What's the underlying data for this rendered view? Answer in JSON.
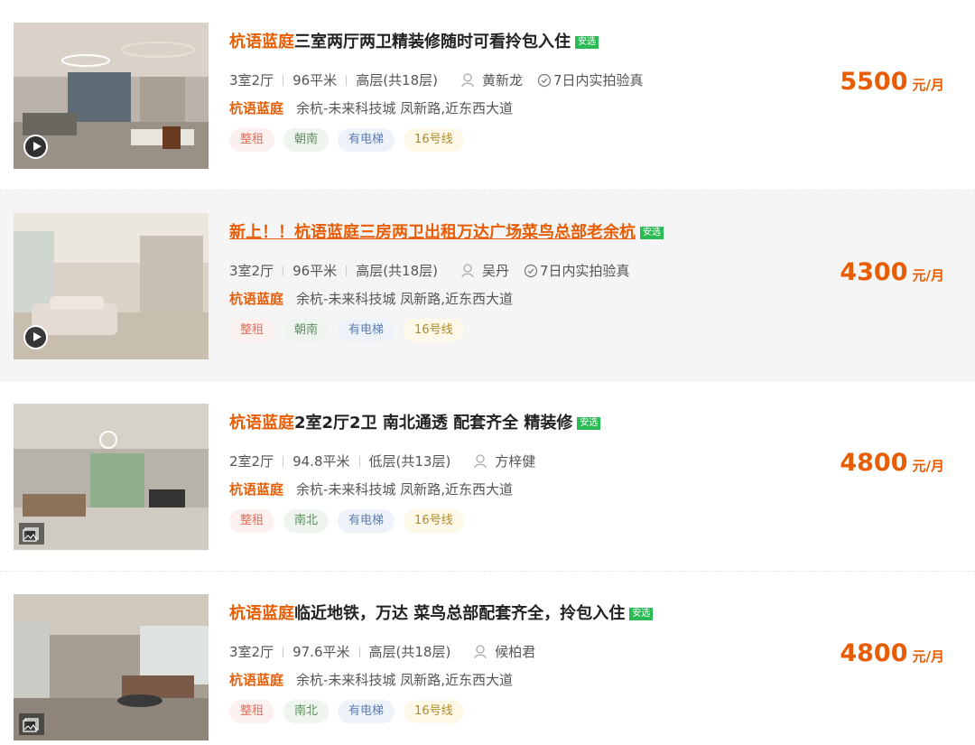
{
  "listings": [
    {
      "title_community": "杭语蓝庭",
      "title_rest": "三室两厅两卫精装修随时可看拎包入住",
      "badge": "安选",
      "layout": "3室2厅",
      "area": "96平米",
      "floor": "高层(共18层)",
      "agent": "黄新龙",
      "verified": "7日内实拍验真",
      "address_community": "杭语蓝庭",
      "address": "余杭-未来科技城 凤新路,近东西大道",
      "tags": [
        "整租",
        "朝南",
        "有电梯",
        "16号线"
      ],
      "price": "5500",
      "price_unit": "元/月",
      "media": "video"
    },
    {
      "title_community": "新上！！杭语蓝庭",
      "title_rest": "三房两卫出租万达广场菜鸟总部老余杭",
      "badge": "安选",
      "layout": "3室2厅",
      "area": "96平米",
      "floor": "高层(共18层)",
      "agent": "吴丹",
      "verified": "7日内实拍验真",
      "address_community": "杭语蓝庭",
      "address": "余杭-未来科技城 凤新路,近东西大道",
      "tags": [
        "整租",
        "朝南",
        "有电梯",
        "16号线"
      ],
      "price": "4300",
      "price_unit": "元/月",
      "media": "video"
    },
    {
      "title_community": "杭语蓝庭",
      "title_rest": " 2室2厅2卫 南北通透 配套齐全 精装修",
      "badge": "安选",
      "layout": "2室2厅",
      "area": "94.8平米",
      "floor": "低层(共13层)",
      "agent": "方梓健",
      "verified": "",
      "address_community": "杭语蓝庭",
      "address": "余杭-未来科技城 凤新路,近东西大道",
      "tags": [
        "整租",
        "南北",
        "有电梯",
        "16号线"
      ],
      "price": "4800",
      "price_unit": "元/月",
      "media": "photo"
    },
    {
      "title_community": "杭语蓝庭",
      "title_rest": " 临近地铁，万达 菜鸟总部配套齐全，拎包入住",
      "badge": "安选",
      "layout": "3室2厅",
      "area": "97.6平米",
      "floor": "高层(共18层)",
      "agent": "候柏君",
      "verified": "",
      "address_community": "杭语蓝庭",
      "address": "余杭-未来科技城 凤新路,近东西大道",
      "tags": [
        "整租",
        "南北",
        "有电梯",
        "16号线"
      ],
      "price": "4800",
      "price_unit": "元/月",
      "media": "photo"
    }
  ]
}
